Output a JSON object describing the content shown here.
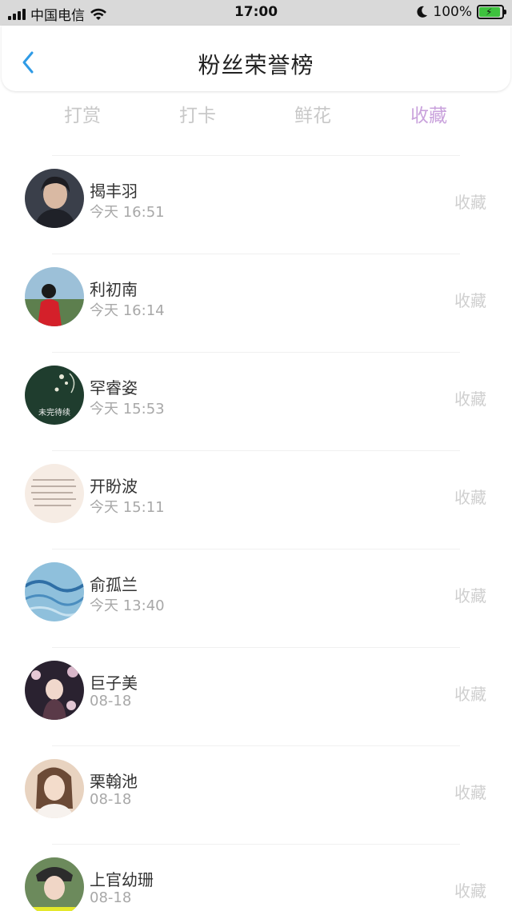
{
  "status_bar": {
    "carrier": "中国电信",
    "time": "17:00",
    "battery": "100%"
  },
  "header": {
    "title": "粉丝荣誉榜"
  },
  "tabs": [
    {
      "label": "打赏"
    },
    {
      "label": "打卡"
    },
    {
      "label": "鲜花"
    },
    {
      "label": "收藏"
    }
  ],
  "active_tab": "收藏",
  "fans": [
    {
      "name": "揭丰羽",
      "time": "今天 16:51",
      "action": "收藏"
    },
    {
      "name": "利初南",
      "time": "今天 16:14",
      "action": "收藏"
    },
    {
      "name": "罕睿姿",
      "time": "今天 15:53",
      "action": "收藏"
    },
    {
      "name": "开盼波",
      "time": "今天 15:11",
      "action": "收藏"
    },
    {
      "name": "俞孤兰",
      "time": "今天 13:40",
      "action": "收藏"
    },
    {
      "name": "巨子美",
      "time": "08-18",
      "action": "收藏"
    },
    {
      "name": "栗翰池",
      "time": "08-18",
      "action": "收藏"
    },
    {
      "name": "上官幼珊",
      "time": "08-18",
      "action": "收藏"
    }
  ],
  "avatar_texts": {
    "fan3": "未完待续"
  },
  "colors": {
    "accent_tab": "#c9a2dc",
    "inactive_tab": "#c8c8c8",
    "back_arrow": "#2f9be6",
    "battery_fill": "#3ec23e"
  }
}
